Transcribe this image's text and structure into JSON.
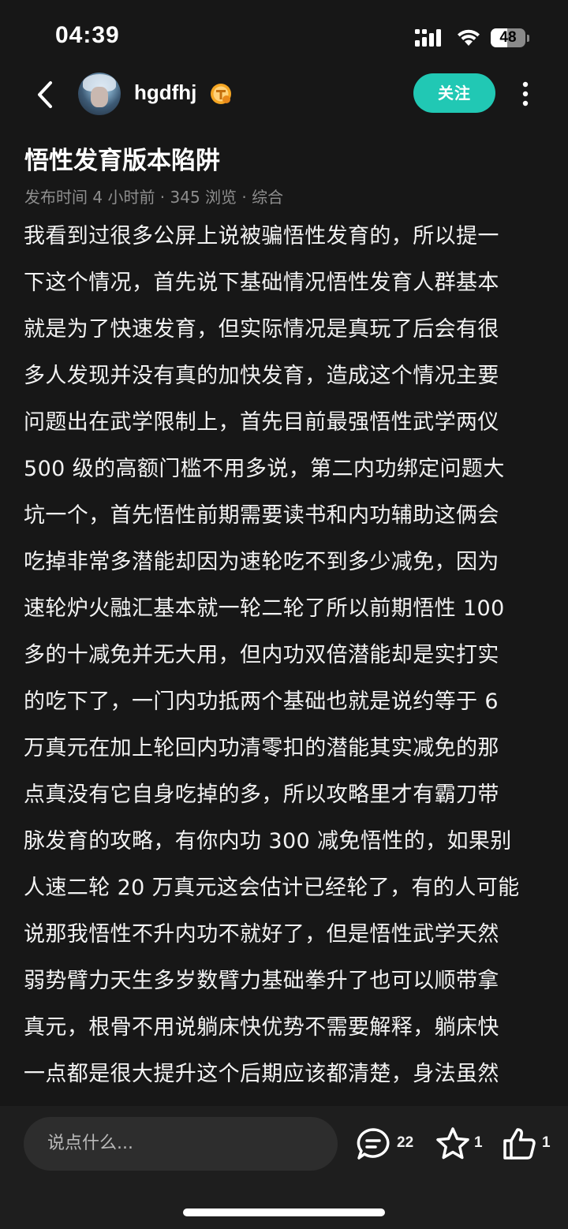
{
  "status_bar": {
    "time": "04:39",
    "battery": "48",
    "battery_level_percent": 48
  },
  "header": {
    "username": "hgdfhj",
    "follow_label": "关注"
  },
  "post": {
    "title": "悟性发育版本陷阱",
    "meta": "发布时间 4 小时前 · 345 浏览 · 综合",
    "lines": [
      "我看到过很多公屏上说被骗悟性发育的，所以提一",
      "下这个情况，首先说下基础情况悟性发育人群基本",
      "就是为了快速发育，但实际情况是真玩了后会有很",
      "多人发现并没有真的加快发育，造成这个情况主要",
      "问题出在武学限制上，首先目前最强悟性武学两仪",
      " 500 级的高额门槛不用多说，第二内功绑定问题大",
      "坑一个，首先悟性前期需要读书和内功辅助这俩会",
      "吃掉非常多潜能却因为速轮吃不到多少减免，因为",
      "速轮炉火融汇基本就一轮二轮了所以前期悟性 100",
      "多的十减免并无大用，但内功双倍潜能却是实打实",
      "的吃下了，一门内功抵两个基础也就是说约等于 6",
      "万真元在加上轮回内功清零扣的潜能其实减免的那",
      "点真没有它自身吃掉的多，所以攻略里才有霸刀带",
      "脉发育的攻略，有你内功 300 减免悟性的，如果别",
      "人速二轮 20 万真元这会估计已经轮了，有的人可能",
      "说那我悟性不升内功不就好了，但是悟性武学天然",
      "弱势臂力天生多岁数臂力基础拳升了也可以顺带拿",
      "真元，根骨不用说躺床快优势不需要解释，躺床快",
      "一点都是很大提升这个后期应该都清楚，身法虽然"
    ]
  },
  "bottom_bar": {
    "comment_placeholder": "说点什么...",
    "comment_count": "22",
    "favorite_count": "1",
    "like_count": "1"
  }
}
